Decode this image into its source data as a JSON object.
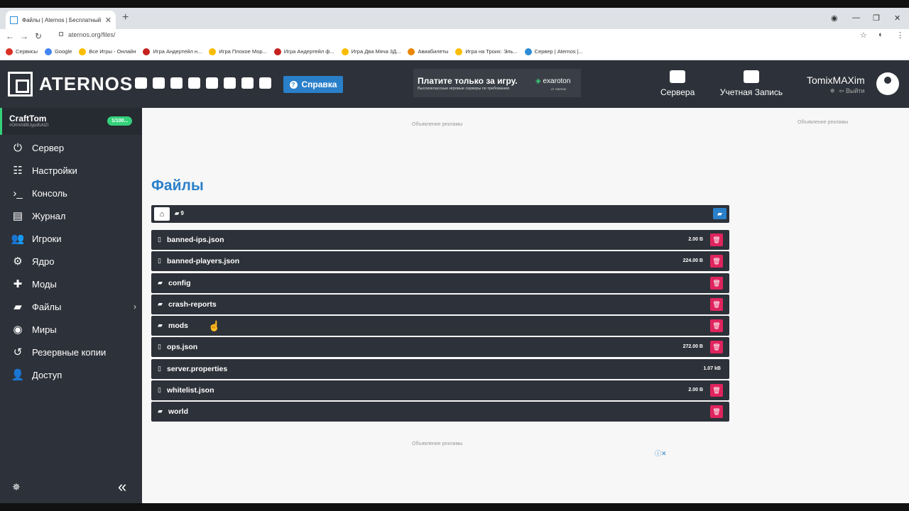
{
  "browser": {
    "tab_title": "Файлы | Aternos | Бесплатный с",
    "tab_close": "✕",
    "url": "aternos.org/files/",
    "bookmarks": [
      {
        "label": "Сервисы",
        "color": "#d93025"
      },
      {
        "label": "Google",
        "color": "#4285f4"
      },
      {
        "label": "Все Игры - Онлайн",
        "color": "#fbbc04"
      },
      {
        "label": "Игра Андертейл н...",
        "color": "#c5221f"
      },
      {
        "label": "Игра Плохое Мор...",
        "color": "#fbbc04"
      },
      {
        "label": "Игра Андертейл ф...",
        "color": "#c5221f"
      },
      {
        "label": "Игра Два Мяча 3Д...",
        "color": "#fbbc04"
      },
      {
        "label": "Авиабилеты",
        "color": "#ea8600"
      },
      {
        "label": "Игра на Троих: Эль...",
        "color": "#fbbc04"
      },
      {
        "label": "Сервер | Aternos |...",
        "color": "#2d8cd6"
      }
    ]
  },
  "header": {
    "logo_text": "ATERNOS",
    "help_label": "Справка",
    "ad_line1": "Платите только за игру.",
    "ad_line2": "Высококлассные игровые серверы по требованию",
    "ad_brand": "exaroton",
    "ad_brand_sub": "от Aternos",
    "servers_label": "Сервера",
    "account_label": "Учетная Запись",
    "username": "TomixMAXim",
    "logout_label": "Выйти"
  },
  "sidebar": {
    "server_name": "CraftTom",
    "server_id": "#O0rkN8BJypdfuNZt",
    "server_badge": "1/100...",
    "items": [
      {
        "label": "Сервер",
        "icon": "power-icon",
        "glyph": "⏻"
      },
      {
        "label": "Настройки",
        "icon": "sliders-icon",
        "glyph": "☷"
      },
      {
        "label": "Консоль",
        "icon": "terminal-icon",
        "glyph": "›_"
      },
      {
        "label": "Журнал",
        "icon": "log-icon",
        "glyph": "▤"
      },
      {
        "label": "Игроки",
        "icon": "players-icon",
        "glyph": "👥"
      },
      {
        "label": "Ядро",
        "icon": "cogs-icon",
        "glyph": "⚙"
      },
      {
        "label": "Моды",
        "icon": "puzzle-icon",
        "glyph": "✚"
      },
      {
        "label": "Файлы",
        "icon": "folder-icon",
        "glyph": "▰"
      },
      {
        "label": "Миры",
        "icon": "globe-icon",
        "glyph": "◉"
      },
      {
        "label": "Резервные копии",
        "icon": "history-icon",
        "glyph": "↺"
      },
      {
        "label": "Доступ",
        "icon": "user-lock-icon",
        "glyph": "👤"
      }
    ]
  },
  "main": {
    "ad_label": "Объявление рекламы",
    "title": "Файлы",
    "path_count": "9",
    "files": [
      {
        "name": "banned-ips.json",
        "type": "file",
        "size": "2.00 B",
        "deletable": true
      },
      {
        "name": "banned-players.json",
        "type": "file",
        "size": "224.00 B",
        "deletable": true
      },
      {
        "name": "config",
        "type": "folder",
        "size": "",
        "deletable": true
      },
      {
        "name": "crash-reports",
        "type": "folder",
        "size": "",
        "deletable": true
      },
      {
        "name": "mods",
        "type": "folder",
        "size": "",
        "deletable": true
      },
      {
        "name": "ops.json",
        "type": "file",
        "size": "272.00 B",
        "deletable": true
      },
      {
        "name": "server.properties",
        "type": "file",
        "size": "1.07 kB",
        "deletable": false
      },
      {
        "name": "whitelist.json",
        "type": "file",
        "size": "2.00 B",
        "deletable": true
      },
      {
        "name": "world",
        "type": "folder",
        "size": "",
        "deletable": true
      }
    ]
  },
  "colors": {
    "accent": "#2a7fc9",
    "dark": "#2d3139",
    "delete": "#e0245e",
    "online": "#33d17a"
  }
}
